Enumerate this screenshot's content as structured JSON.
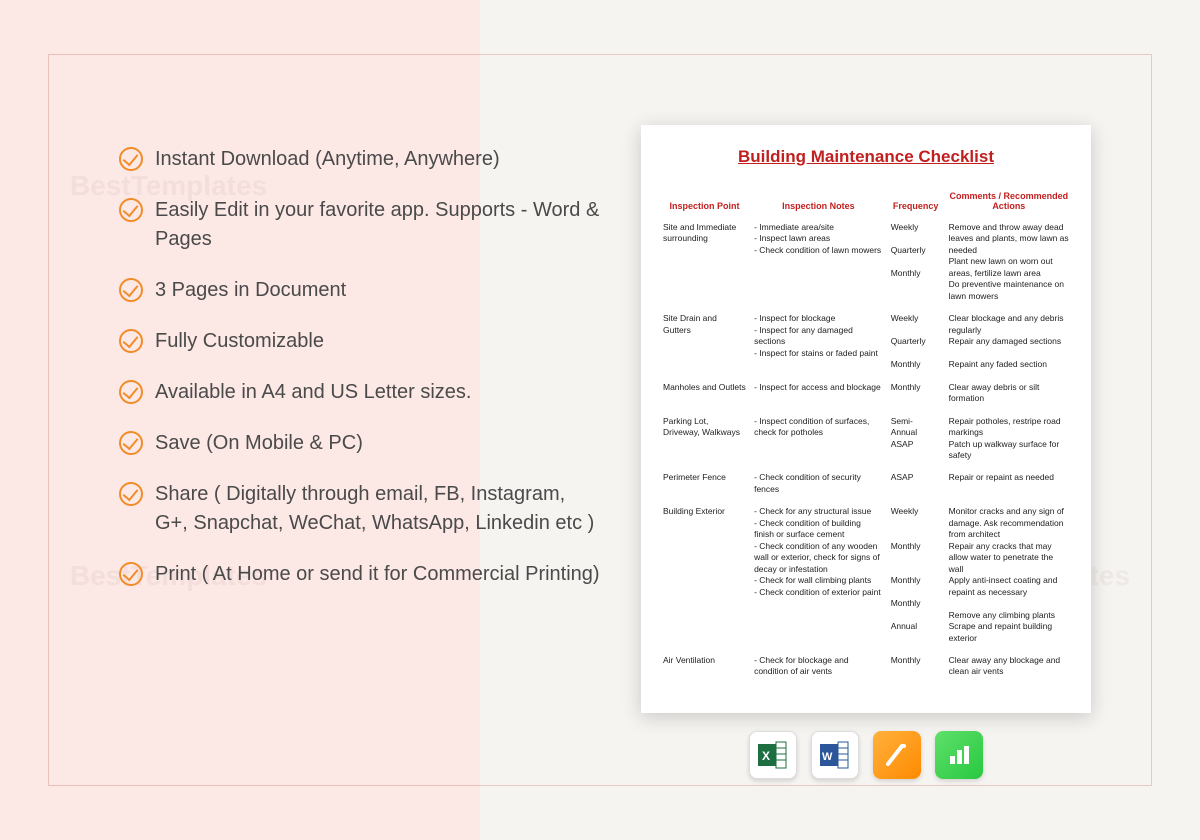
{
  "watermark": "BestTemplates",
  "features": [
    "Instant Download (Anytime, Anywhere)",
    "Easily Edit in your favorite app. Supports - Word & Pages",
    "3 Pages in Document",
    "Fully Customizable",
    "Available in A4 and US Letter sizes.",
    "Save (On Mobile & PC)",
    "Share ( Digitally through email, FB, Instagram, G+, Snapchat, WeChat, WhatsApp, Linkedin etc )",
    "Print ( At Home or send it for Commercial Printing)"
  ],
  "document": {
    "title": "Building Maintenance Checklist",
    "headers": {
      "inspection_point": "Inspection Point",
      "inspection_notes": "Inspection Notes",
      "frequency": "Frequency",
      "comments": "Comments / Recommended Actions"
    },
    "rows": [
      {
        "point": "Site and Immediate surrounding",
        "notes": "- Immediate area/site\n- Inspect lawn areas\n- Check condition of lawn mowers",
        "freq": "Weekly\n\nQuarterly\n\nMonthly",
        "comments": "Remove and throw away dead leaves and plants, mow lawn as needed\nPlant new lawn on worn out areas, fertilize lawn area\nDo preventive maintenance on lawn mowers"
      },
      {
        "point": "Site Drain and Gutters",
        "notes": "- Inspect for blockage\n- Inspect for any damaged sections\n- Inspect for stains or faded paint",
        "freq": "Weekly\n\nQuarterly\n\nMonthly",
        "comments": "Clear blockage and any debris regularly\nRepair any damaged sections\n\nRepaint any faded section"
      },
      {
        "point": "Manholes and Outlets",
        "notes": "- Inspect for access and blockage",
        "freq": "Monthly",
        "comments": "Clear away debris or silt formation"
      },
      {
        "point": "Parking Lot, Driveway, Walkways",
        "notes": "- Inspect condition of surfaces, check for potholes",
        "freq": "Semi- Annual\nASAP",
        "comments": "Repair potholes, restripe road markings\nPatch up walkway surface for safety"
      },
      {
        "point": "Perimeter Fence",
        "notes": "- Check condition of security fences",
        "freq": "ASAP",
        "comments": "Repair or repaint as needed"
      },
      {
        "point": "Building Exterior",
        "notes": "- Check for any structural issue\n- Check condition of building finish or surface cement\n- Check condition of any wooden wall or exterior, check for signs of decay or infestation\n- Check for wall climbing plants\n- Check condition of exterior paint",
        "freq": "Weekly\n\n\nMonthly\n\n\nMonthly\n\nMonthly\n\nAnnual",
        "comments": "Monitor cracks and any sign of damage. Ask recommendation from architect\nRepair any cracks that may allow water to penetrate the wall\nApply anti-insect coating and repaint as necessary\n\nRemove any climbing plants\nScrape and repaint building exterior"
      },
      {
        "point": "Air Ventilation",
        "notes": "- Check for blockage and condition of air vents",
        "freq": "Monthly",
        "comments": "Clear away any blockage and clean air vents"
      }
    ]
  },
  "apps": [
    "excel-icon",
    "word-icon",
    "pages-icon",
    "numbers-icon"
  ]
}
